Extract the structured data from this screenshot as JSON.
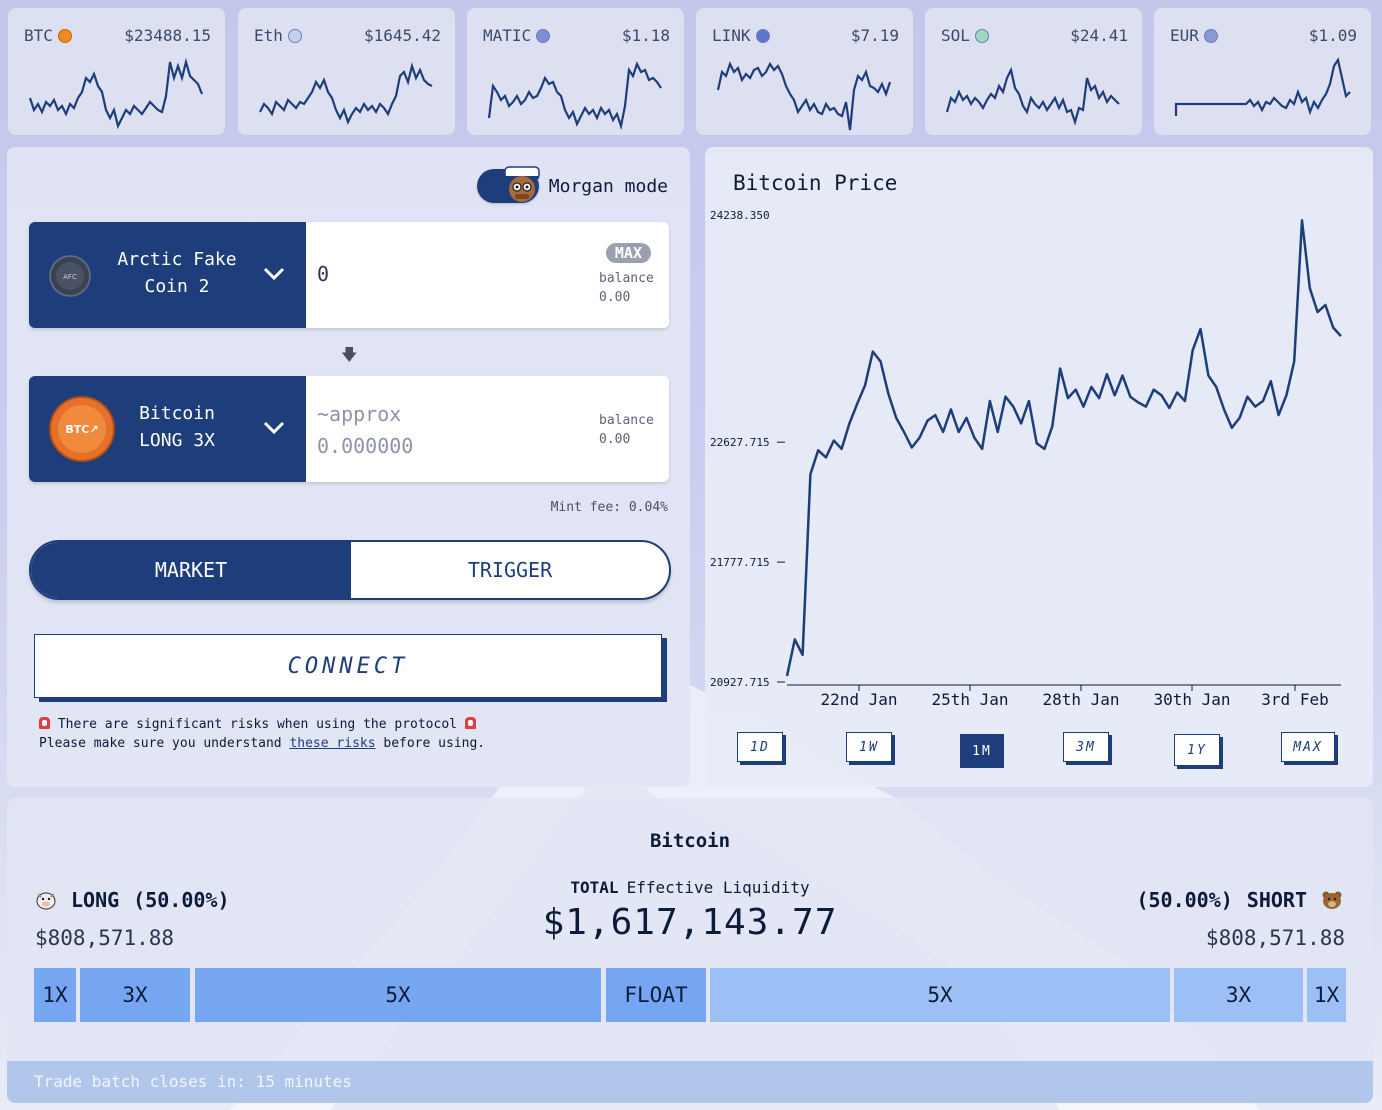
{
  "tickers": [
    {
      "symbol": "BTC",
      "price": "$23488.15",
      "active": true,
      "coin_color": "#f08a1f"
    },
    {
      "symbol": "Eth",
      "price": "$1645.42",
      "active": false,
      "coin_color": "#8fa4d8"
    },
    {
      "symbol": "MATIC",
      "price": "$1.18",
      "active": false,
      "coin_color": "#5b6fc4"
    },
    {
      "symbol": "LINK",
      "price": "$7.19",
      "active": false,
      "coin_color": "#4662c0"
    },
    {
      "symbol": "SOL",
      "price": "$24.41",
      "active": false,
      "coin_color": "#6fc6a0"
    },
    {
      "symbol": "EUR",
      "price": "$1.09",
      "active": false,
      "coin_color": "#5c74c6"
    }
  ],
  "trade": {
    "morgan_mode_label": "Morgan mode",
    "from_token": {
      "name_line1": "Arctic Fake",
      "name_line2": "Coin 2",
      "logo_text": "AFC",
      "amount": "0",
      "max_label": "MAX",
      "balance_label": "balance",
      "balance_value": "0.00"
    },
    "to_token": {
      "name_line1": "Bitcoin",
      "name_line2": "LONG 3X",
      "logo_text": "BTC↗",
      "approx_label": "~approx",
      "amount": "0.000000",
      "balance_label": "balance",
      "balance_value": "0.00"
    },
    "mint_fee": "Mint fee: 0.04%",
    "tabs": {
      "market": "MARKET",
      "trigger": "TRIGGER"
    },
    "connect_label": "CONNECT",
    "risk_line1": "There are significant risks when using the protocol",
    "risk_line2_pre": "Please make sure you understand ",
    "risk_link": "these risks",
    "risk_line2_post": " before using."
  },
  "chart": {
    "title": "Bitcoin Price",
    "y_ticks": [
      "24238.350",
      "22627.715",
      "21777.715",
      "20927.715"
    ],
    "x_ticks": [
      "22nd Jan",
      "25th Jan",
      "28th Jan",
      "30th Jan",
      "3rd Feb"
    ],
    "ranges": [
      "1D",
      "1W",
      "1M",
      "3M",
      "1Y",
      "MAX"
    ],
    "active_range": "1M",
    "line_color": "#1e3d7b"
  },
  "chart_data": {
    "type": "line",
    "title": "Bitcoin Price",
    "xlabel": "",
    "ylabel": "",
    "x_ticks": [
      "22nd Jan",
      "25th Jan",
      "28th Jan",
      "30th Jan",
      "3rd Feb"
    ],
    "ylim": [
      20927.715,
      24238.35
    ],
    "series": [
      {
        "values": [
          20970,
          21230,
          21120,
          22400,
          22570,
          22520,
          22640,
          22580,
          22760,
          22900,
          23030,
          23270,
          23200,
          22970,
          22800,
          22700,
          22590,
          22660,
          22780,
          22820,
          22700,
          22860,
          22700,
          22800,
          22660,
          22580,
          22920,
          22700,
          22950,
          22880,
          22760,
          22920,
          22620,
          22580,
          22740,
          23150,
          22940,
          23000,
          22880,
          23020,
          22940,
          23110,
          22960,
          23100,
          22950,
          22910,
          22880,
          23000,
          22960,
          22870,
          22980,
          22920,
          23280,
          23430,
          23100,
          23020,
          22860,
          22730,
          22800,
          22950,
          22880,
          22920,
          23060,
          22820,
          22960,
          23200,
          24200,
          23720,
          23550,
          23600,
          23440,
          23380
        ]
      }
    ]
  },
  "liquidity": {
    "asset": "Bitcoin",
    "total_label_bold": "TOTAL",
    "total_label": "Effective Liquidity",
    "total": "$1,617,143.77",
    "long_label": "LONG",
    "long_pct": "(50.00%)",
    "long_value": "$808,571.88",
    "short_label": "SHORT",
    "short_pct": "(50.00%)",
    "short_value": "$808,571.88",
    "segments": [
      {
        "label": "1X",
        "side": "long"
      },
      {
        "label": "3X",
        "side": "long"
      },
      {
        "label": "5X",
        "side": "long"
      },
      {
        "label": "FLOAT",
        "side": "float"
      },
      {
        "label": "5X",
        "side": "short"
      },
      {
        "label": "3X",
        "side": "short"
      },
      {
        "label": "1X",
        "side": "short"
      }
    ],
    "batch_text": "Trade batch closes in: 15 minutes"
  }
}
